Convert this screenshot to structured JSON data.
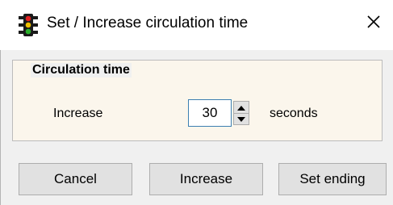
{
  "window": {
    "title": "Set / Increase circulation time",
    "icon": "traffic-light-icon",
    "close_glyph": "✕"
  },
  "group": {
    "title": "Circulation time",
    "increase_label": "Increase",
    "value": "30",
    "unit_label": "seconds"
  },
  "buttons": {
    "cancel": "Cancel",
    "increase": "Increase",
    "set_ending": "Set ending"
  },
  "colors": {
    "group_background": "#fbf6ec",
    "input_border_focus": "#3c7fb1",
    "button_face": "#e1e1e1"
  }
}
